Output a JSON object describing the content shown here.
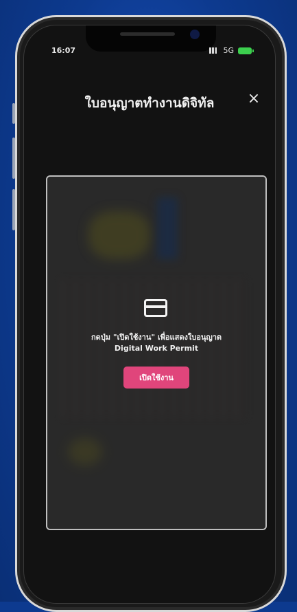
{
  "status_bar": {
    "time": "16:07",
    "network": "5G"
  },
  "header": {
    "title": "ใบอนุญาตทำงานดิจิทัล",
    "close_glyph": "×"
  },
  "permit": {
    "message_line1": "กดปุ่ม \"เปิดใช้งาน\" เพื่อแสดงใบอนุญาต",
    "message_line2": "Digital Work Permit",
    "button_label": "เปิดใช้งาน"
  },
  "colors": {
    "background": "#0d3a8f",
    "button": "#e0457b",
    "screen": "#121212"
  },
  "icons": [
    "signal-icon",
    "battery-icon",
    "close-icon",
    "card-icon"
  ]
}
